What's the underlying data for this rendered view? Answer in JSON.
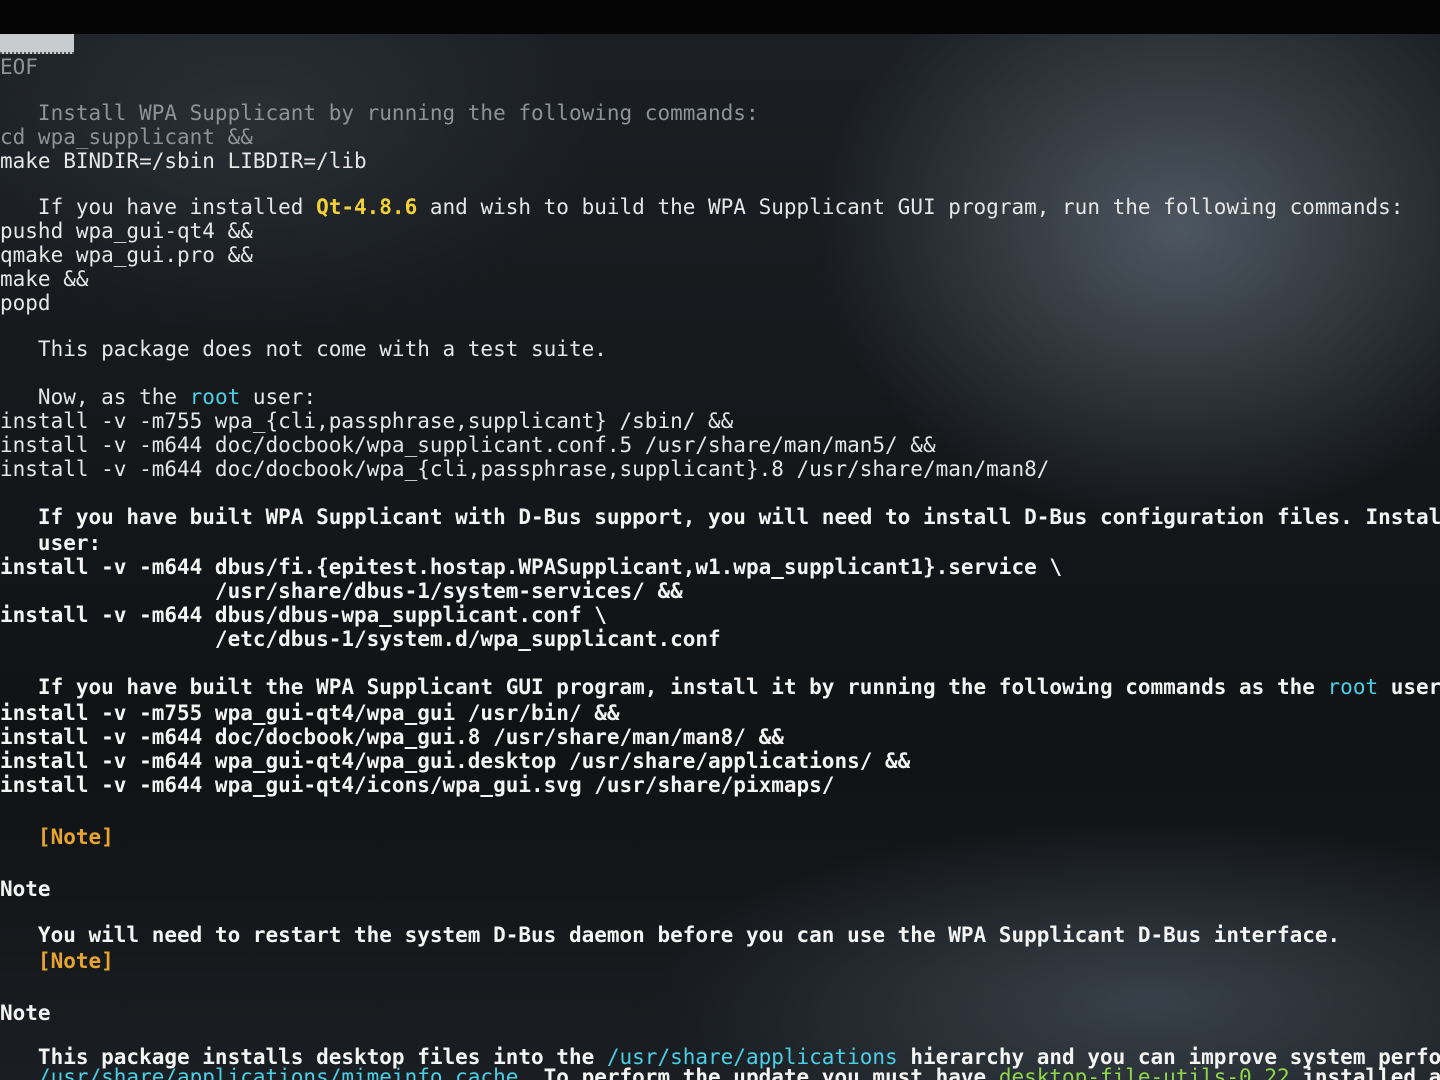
{
  "tab_indicator": "",
  "lines": [
    {
      "segments": [
        {
          "t": "EOF",
          "c": "dim"
        }
      ]
    },
    {
      "segments": [
        {
          "t": "   Install WPA Supplicant by running the following commands:",
          "c": "dim"
        }
      ]
    },
    {
      "segments": [
        {
          "t": "cd wpa_supplicant &&",
          "c": "dim"
        }
      ]
    },
    {
      "segments": [
        {
          "t": "make BINDIR=/sbin LIBDIR=/lib",
          "c": ""
        }
      ]
    },
    {
      "segments": [
        {
          "t": "   If you have installed ",
          "c": ""
        },
        {
          "t": "Qt-4.8.6",
          "c": "yellow"
        },
        {
          "t": " and wish to build the WPA Supplicant GUI program, run the following commands:",
          "c": ""
        }
      ]
    },
    {
      "segments": [
        {
          "t": "pushd wpa_gui-qt4 &&",
          "c": ""
        }
      ]
    },
    {
      "segments": [
        {
          "t": "qmake wpa_gui.pro &&",
          "c": ""
        }
      ]
    },
    {
      "segments": [
        {
          "t": "make &&",
          "c": ""
        }
      ]
    },
    {
      "segments": [
        {
          "t": "popd",
          "c": ""
        }
      ]
    },
    {
      "segments": [
        {
          "t": "   This package does not come with a test suite.",
          "c": ""
        }
      ]
    },
    {
      "segments": [
        {
          "t": "   Now, as the ",
          "c": ""
        },
        {
          "t": "root",
          "c": "cyan"
        },
        {
          "t": " user:",
          "c": ""
        }
      ]
    },
    {
      "segments": [
        {
          "t": "install -v -m755 wpa_{cli,passphrase,supplicant} /sbin/ &&",
          "c": ""
        }
      ]
    },
    {
      "segments": [
        {
          "t": "install -v -m644 doc/docbook/wpa_supplicant.conf.5 /usr/share/man/man5/ &&",
          "c": ""
        }
      ]
    },
    {
      "segments": [
        {
          "t": "install -v -m644 doc/docbook/wpa_{cli,passphrase,supplicant}.8 /usr/share/man/man8/",
          "c": ""
        }
      ]
    },
    {
      "segments": [
        {
          "t": "   If you have built WPA Supplicant with D-Bus support, you will need to install D-Bus configuration files. Install th",
          "c": "bright"
        }
      ]
    },
    {
      "segments": [
        {
          "t": "   user:",
          "c": "bright"
        }
      ]
    },
    {
      "segments": [
        {
          "t": "install -v -m644 dbus/fi.{epitest.hostap.WPASupplicant,w1.wpa_supplicant1}.service \\",
          "c": "bright"
        }
      ]
    },
    {
      "segments": [
        {
          "t": "                 /usr/share/dbus-1/system-services/ &&",
          "c": "bright"
        }
      ]
    },
    {
      "segments": [
        {
          "t": "install -v -m644 dbus/dbus-wpa_supplicant.conf \\",
          "c": "bright"
        }
      ]
    },
    {
      "segments": [
        {
          "t": "                 /etc/dbus-1/system.d/wpa_supplicant.conf",
          "c": "bright"
        }
      ]
    },
    {
      "segments": [
        {
          "t": "   If you have built the WPA Supplicant GUI program, install it by running the following commands as the ",
          "c": "bright"
        },
        {
          "t": "root",
          "c": "cyan"
        },
        {
          "t": " user:",
          "c": "bright"
        }
      ]
    },
    {
      "segments": [
        {
          "t": "install -v -m755 wpa_gui-qt4/wpa_gui /usr/bin/ &&",
          "c": "bright"
        }
      ]
    },
    {
      "segments": [
        {
          "t": "install -v -m644 doc/docbook/wpa_gui.8 /usr/share/man/man8/ &&",
          "c": "bright"
        }
      ]
    },
    {
      "segments": [
        {
          "t": "install -v -m644 wpa_gui-qt4/wpa_gui.desktop /usr/share/applications/ &&",
          "c": "bright"
        }
      ]
    },
    {
      "segments": [
        {
          "t": "install -v -m644 wpa_gui-qt4/icons/wpa_gui.svg /usr/share/pixmaps/",
          "c": "bright"
        }
      ]
    },
    {
      "segments": [
        {
          "t": "   [Note]",
          "c": "orange"
        }
      ]
    },
    {
      "segments": [
        {
          "t": "Note",
          "c": "bright"
        }
      ]
    },
    {
      "segments": [
        {
          "t": "   You will need to restart the system D-Bus daemon before you can use the WPA Supplicant D-Bus interface.",
          "c": "bright"
        }
      ]
    },
    {
      "segments": [
        {
          "t": "   [Note]",
          "c": "orange"
        }
      ]
    },
    {
      "segments": [
        {
          "t": "Note",
          "c": "bright"
        }
      ]
    },
    {
      "segments": [
        {
          "t": "   This package installs desktop files into the ",
          "c": "bright"
        },
        {
          "t": "/usr/share/applications",
          "c": "cyan"
        },
        {
          "t": " hierarchy and you can improve system perform",
          "c": "bright"
        }
      ]
    },
    {
      "segments": [
        {
          "t": "   /usr/share/applications/mimeinfo.cache",
          "c": "cyan"
        },
        {
          "t": ". To perform the update you must have ",
          "c": "bright"
        },
        {
          "t": "desktop-file-utils-0.22",
          "c": "green"
        },
        {
          "t": " installed and",
          "c": "bright"
        }
      ]
    }
  ]
}
